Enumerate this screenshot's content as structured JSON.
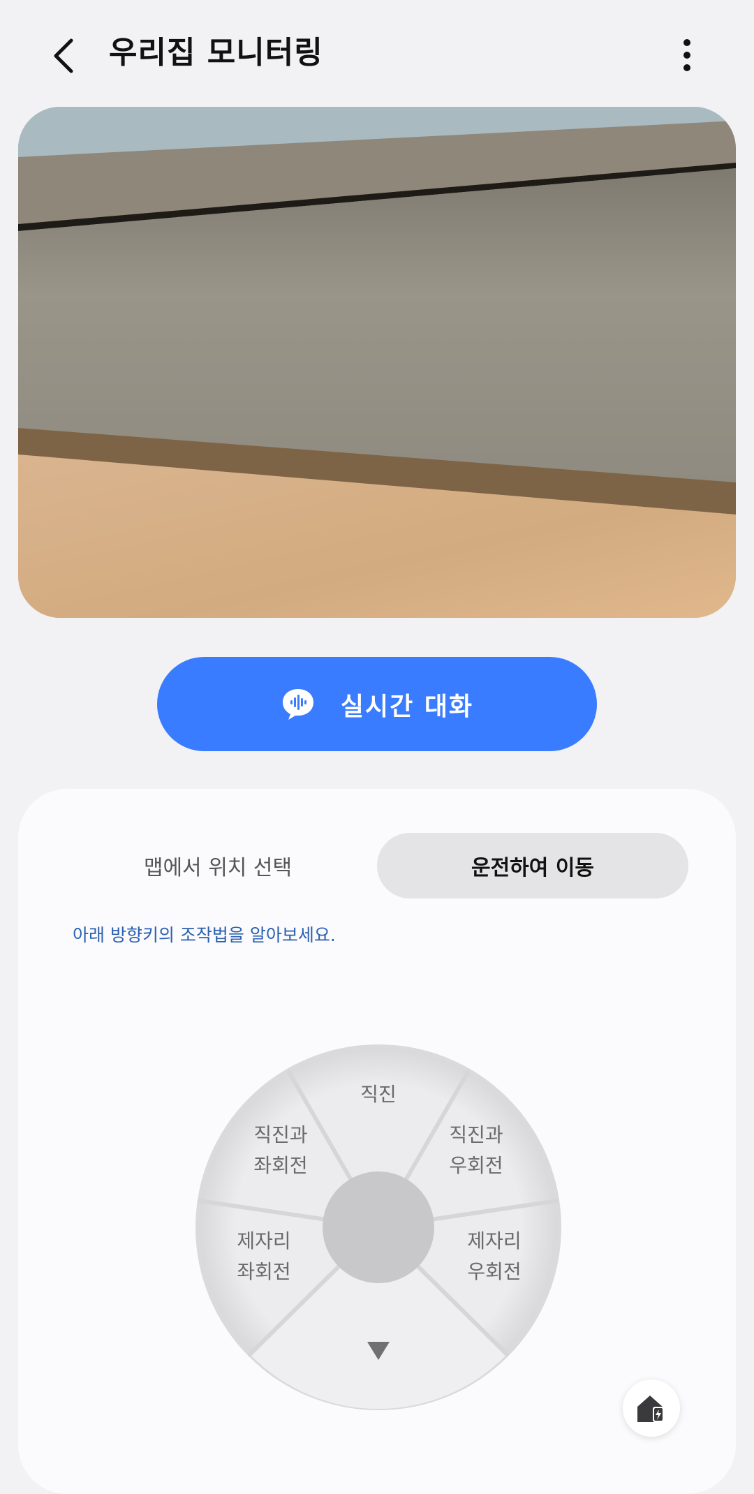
{
  "header": {
    "title": "우리집 모니터링",
    "back_icon": "chevron-left-icon",
    "more_icon": "more-vertical-icon"
  },
  "talk_button": {
    "label": "실시간 대화",
    "icon": "voice-chat-bubble-icon",
    "color": "#3a7cff"
  },
  "tabs": [
    {
      "label": "맵에서 위치 선택",
      "selected": false
    },
    {
      "label": "운전하여 이동",
      "selected": true
    }
  ],
  "hint": "아래 방향키의 조작법을 알아보세요.",
  "joystick": {
    "forward": "직진",
    "forward_left": [
      "직진과",
      "좌회전"
    ],
    "forward_right": [
      "직진과",
      "우회전"
    ],
    "spin_left": [
      "제자리",
      "좌회전"
    ],
    "spin_right": [
      "제자리",
      "우회전"
    ],
    "back_icon": "triangle-down-icon"
  },
  "fab": {
    "icon": "home-battery-icon"
  }
}
